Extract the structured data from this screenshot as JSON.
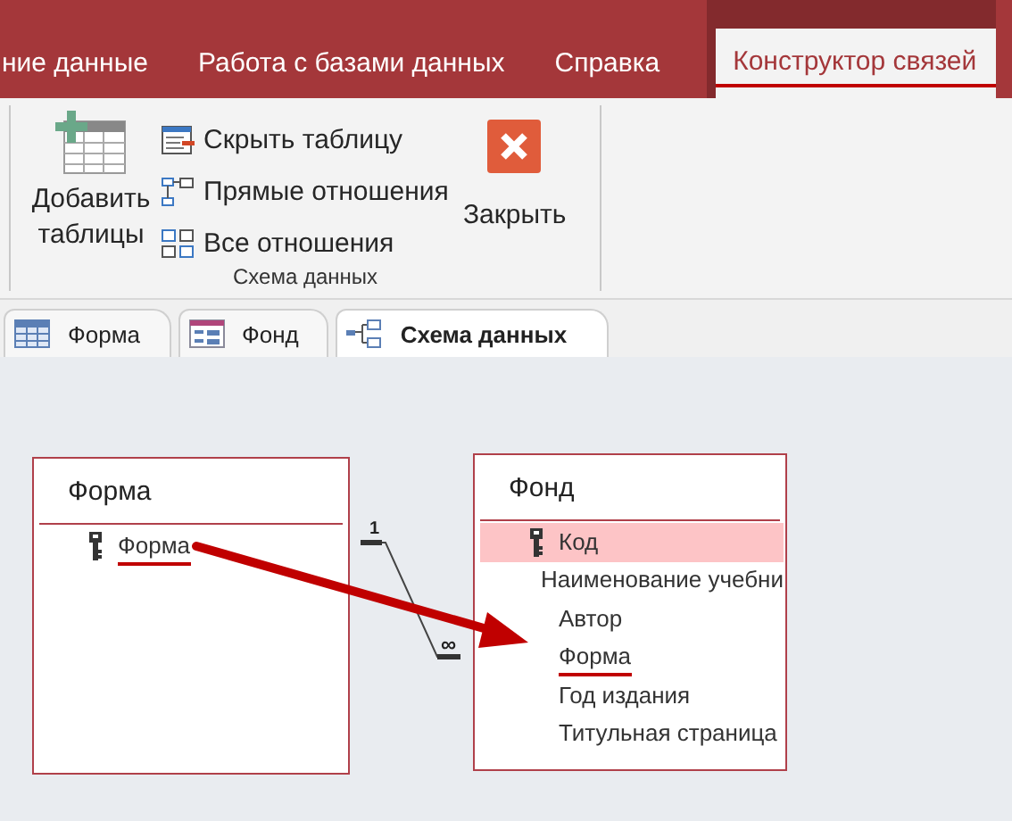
{
  "ribbon_tabs": [
    {
      "label": "ние данные",
      "selected": false
    },
    {
      "label": "Работа с базами данных",
      "selected": false
    },
    {
      "label": "Справка",
      "selected": false
    },
    {
      "label": "Конструктор связей",
      "selected": true
    }
  ],
  "ribbon": {
    "add_button": {
      "label": "Добавить таблицы"
    },
    "view_buttons": [
      {
        "label": "Скрыть таблицу"
      },
      {
        "label": "Прямые отношения"
      },
      {
        "label": "Все отношения"
      }
    ],
    "close_button": {
      "label": "Закрыть"
    },
    "group_label": "Схема данных"
  },
  "doc_tabs": [
    {
      "label": "Форма",
      "kind": "table",
      "selected": false
    },
    {
      "label": "Фонд",
      "kind": "form",
      "selected": false
    },
    {
      "label": "Схема данных",
      "kind": "relationships",
      "selected": true
    }
  ],
  "diagram": {
    "tables": [
      {
        "title": "Форма",
        "fields": [
          {
            "name": "Форма",
            "primary_key": true,
            "selected": false,
            "marked": true
          }
        ]
      },
      {
        "title": "Фонд",
        "fields": [
          {
            "name": "Код",
            "primary_key": true,
            "selected": true,
            "marked": false
          },
          {
            "name": "Наименование учебни",
            "primary_key": false,
            "selected": false,
            "marked": false
          },
          {
            "name": "Автор",
            "primary_key": false,
            "selected": false,
            "marked": false
          },
          {
            "name": "Форма",
            "primary_key": false,
            "selected": false,
            "marked": true
          },
          {
            "name": "Год издания",
            "primary_key": false,
            "selected": false,
            "marked": false
          },
          {
            "name": "Титульная страница",
            "primary_key": false,
            "selected": false,
            "marked": false
          }
        ]
      }
    ],
    "relationship": {
      "one_label": "1",
      "many_label": "∞"
    }
  }
}
